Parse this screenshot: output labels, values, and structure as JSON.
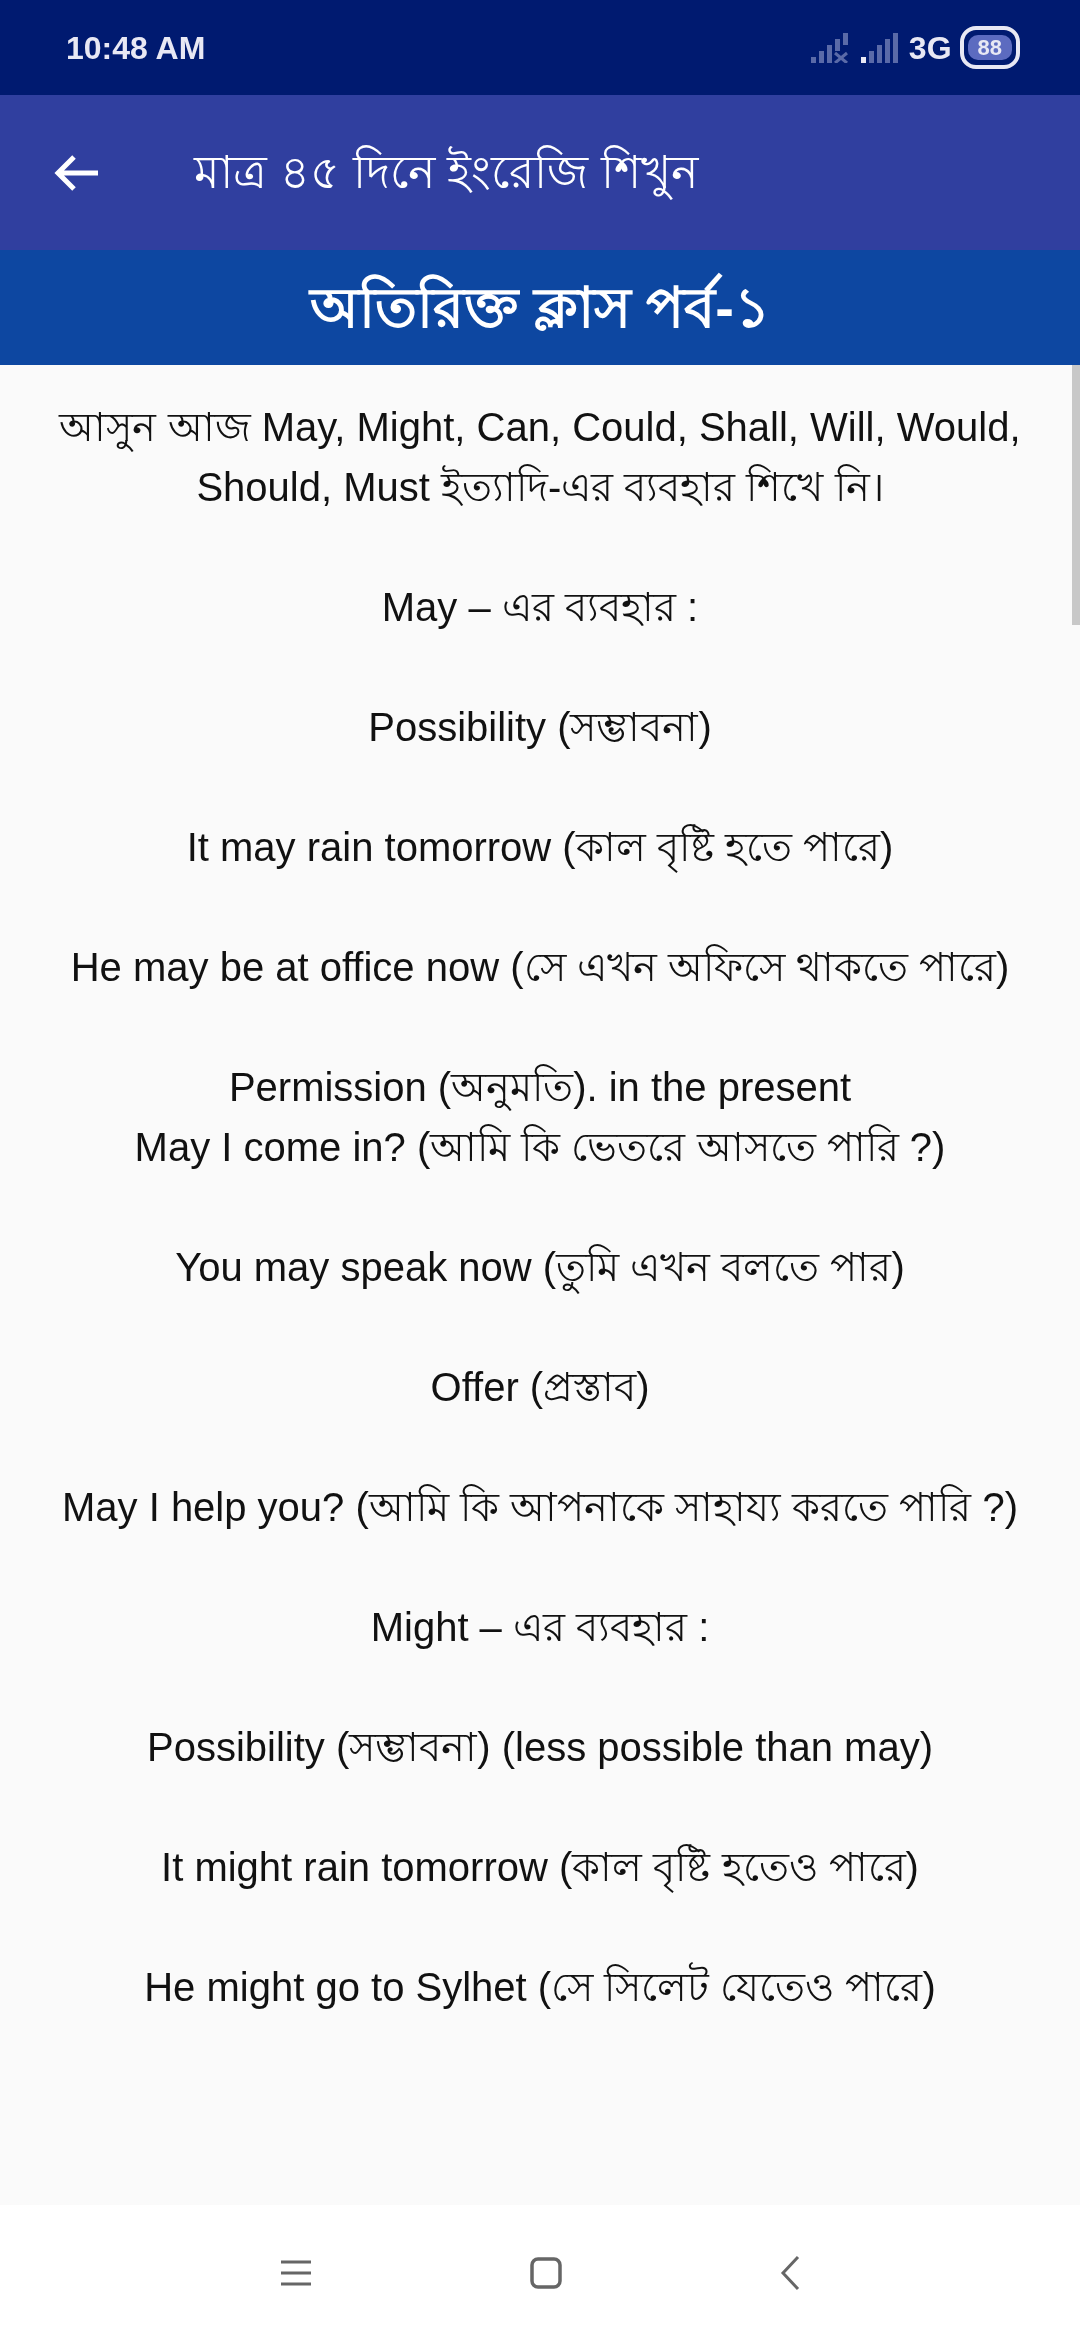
{
  "status_bar": {
    "time": "10:48 AM",
    "network": "3G",
    "battery": "88"
  },
  "app_bar": {
    "title": "মাত্র ৪৫ দিনে ইংরেজি শিখুন"
  },
  "banner": {
    "title": "অতিরিক্ত ক্লাস পর্ব-১"
  },
  "paragraphs": [
    {
      "lines": [
        "আসুন আজ May, Might, Can, Could, Shall, Will, Would, Should, Must ইত্যাদি-এর ব্যবহার শিখে নি।"
      ]
    },
    {
      "lines": [
        "May – এর ব্যবহার :"
      ]
    },
    {
      "lines": [
        "Possibility (সম্ভাবনা)"
      ]
    },
    {
      "lines": [
        "It may rain tomorrow (কাল বৃষ্টি হতে পারে)"
      ]
    },
    {
      "lines": [
        "He may be at office now (সে এখন অফিসে থাকতে পারে)"
      ]
    },
    {
      "lines": [
        "Permission (অনুমতি). in the present",
        "May I come in? (আমি কি ভেতরে আসতে পারি ?)"
      ]
    },
    {
      "lines": [
        "You may speak now (তুমি এখন বলতে পার)"
      ]
    },
    {
      "lines": [
        "Offer (প্রস্তাব)"
      ]
    },
    {
      "lines": [
        "May I help you? (আমি কি আপনাকে সাহায্য করতে পারি ?)"
      ]
    },
    {
      "lines": [
        "Might – এর ব্যবহার :"
      ]
    },
    {
      "lines": [
        "Possibility (সম্ভাবনা) (less possible than may)"
      ]
    },
    {
      "lines": [
        "It might rain tomorrow (কাল বৃষ্টি হতেও পারে)"
      ]
    },
    {
      "lines": [
        "He might go to Sylhet (সে সিলেট যেতেও পারে)"
      ]
    }
  ]
}
